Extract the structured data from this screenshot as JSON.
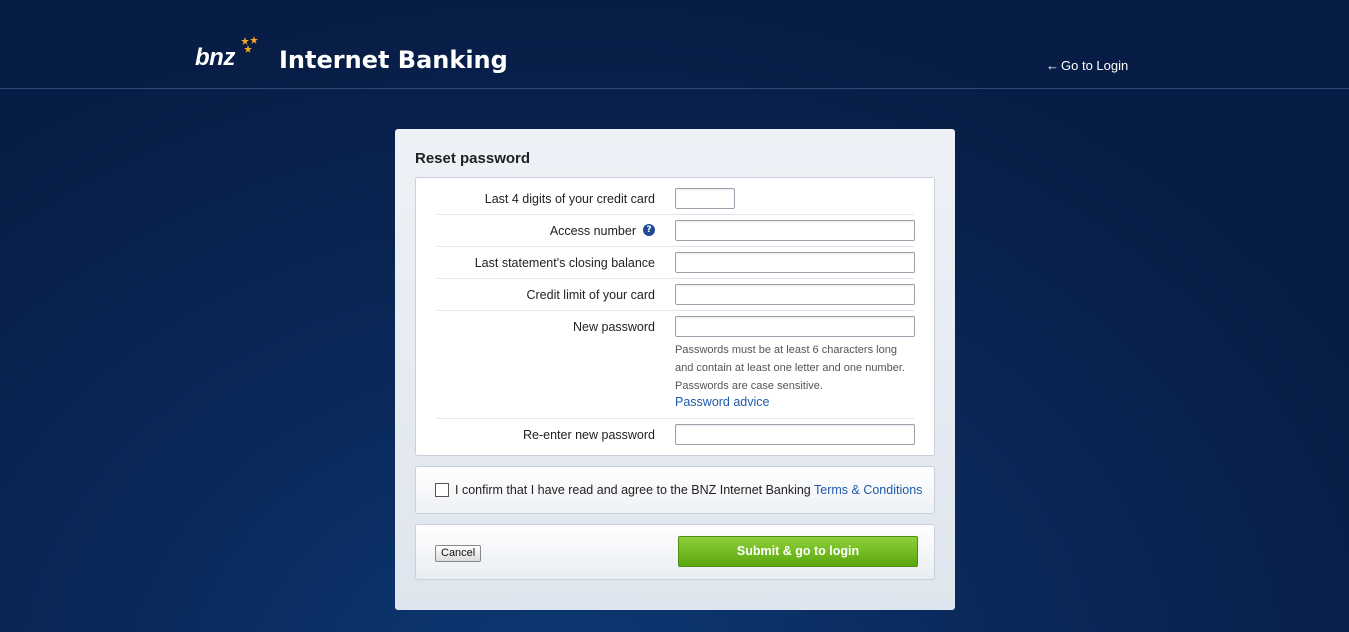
{
  "header": {
    "logo_text": "bnz",
    "title": "Internet Banking",
    "go_to_login": "Go to Login",
    "star_color": "#f5a623"
  },
  "panel": {
    "title": "Reset password",
    "fields": [
      {
        "label": "Last 4 digits of your credit card",
        "value": ""
      },
      {
        "label": "Access number",
        "value": "",
        "help_icon": "question-icon"
      },
      {
        "label": "Last statement's closing balance",
        "value": ""
      },
      {
        "label": "Credit limit of your card",
        "value": ""
      },
      {
        "label": "New password",
        "value": ""
      },
      {
        "label": "Re-enter new password",
        "value": ""
      }
    ],
    "password_hint_lines": [
      "Passwords must be at least 6 characters long",
      "and contain at least one letter and one number.",
      "Passwords are case sensitive."
    ],
    "password_advice_link": "Password advice"
  },
  "confirm": {
    "text": "I confirm that I have read and agree to the BNZ Internet Banking",
    "terms_link": "Terms & Conditions",
    "checked": false
  },
  "actions": {
    "cancel_label": "Cancel",
    "submit_label": "Submit & go to login",
    "submit_color": "#6fb820"
  }
}
